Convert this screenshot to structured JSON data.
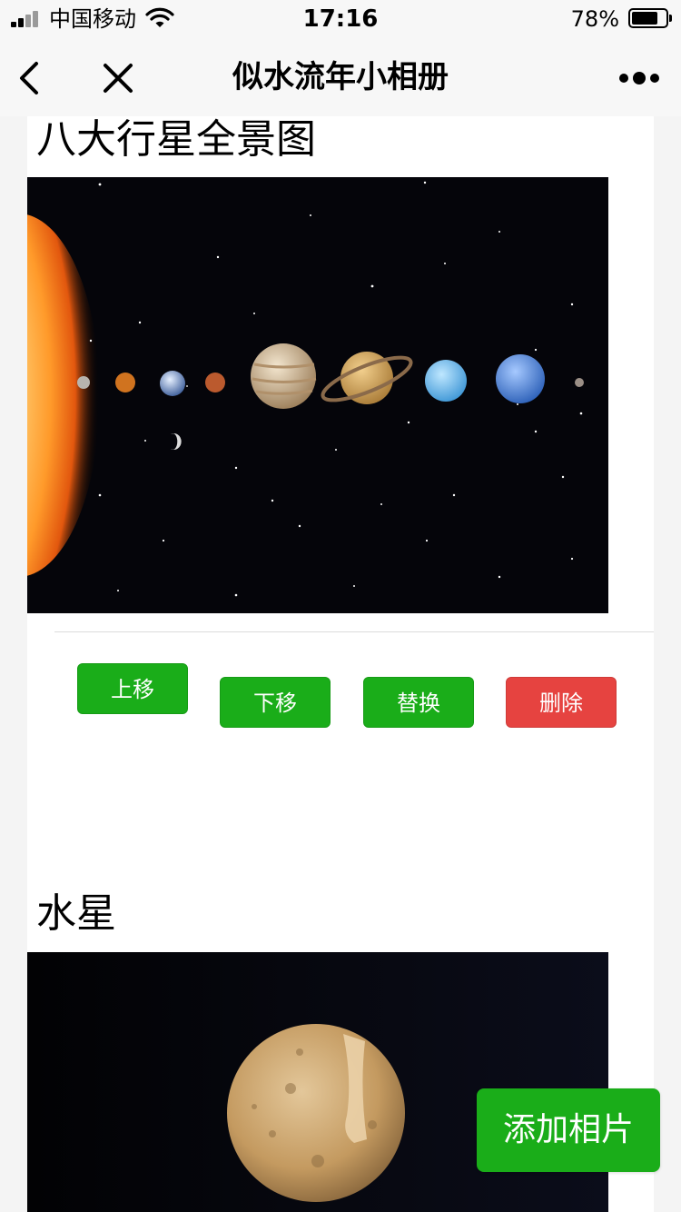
{
  "status_bar": {
    "carrier": "中国移动",
    "time": "17:16",
    "battery": "78%",
    "battery_level": 0.78
  },
  "nav": {
    "title": "似水流年小相册",
    "back_icon": "chevron-left-icon",
    "close_icon": "close-icon",
    "more_icon": "more-dots-icon"
  },
  "photos": [
    {
      "title": "八大行星全景图",
      "actions": {
        "move_up": "上移",
        "move_down": "下移",
        "replace": "替换",
        "delete": "删除"
      }
    },
    {
      "title": "水星"
    }
  ],
  "fab": {
    "label": "添加相片"
  },
  "colors": {
    "primary_green": "#1aad19",
    "danger_red": "#e64340"
  }
}
